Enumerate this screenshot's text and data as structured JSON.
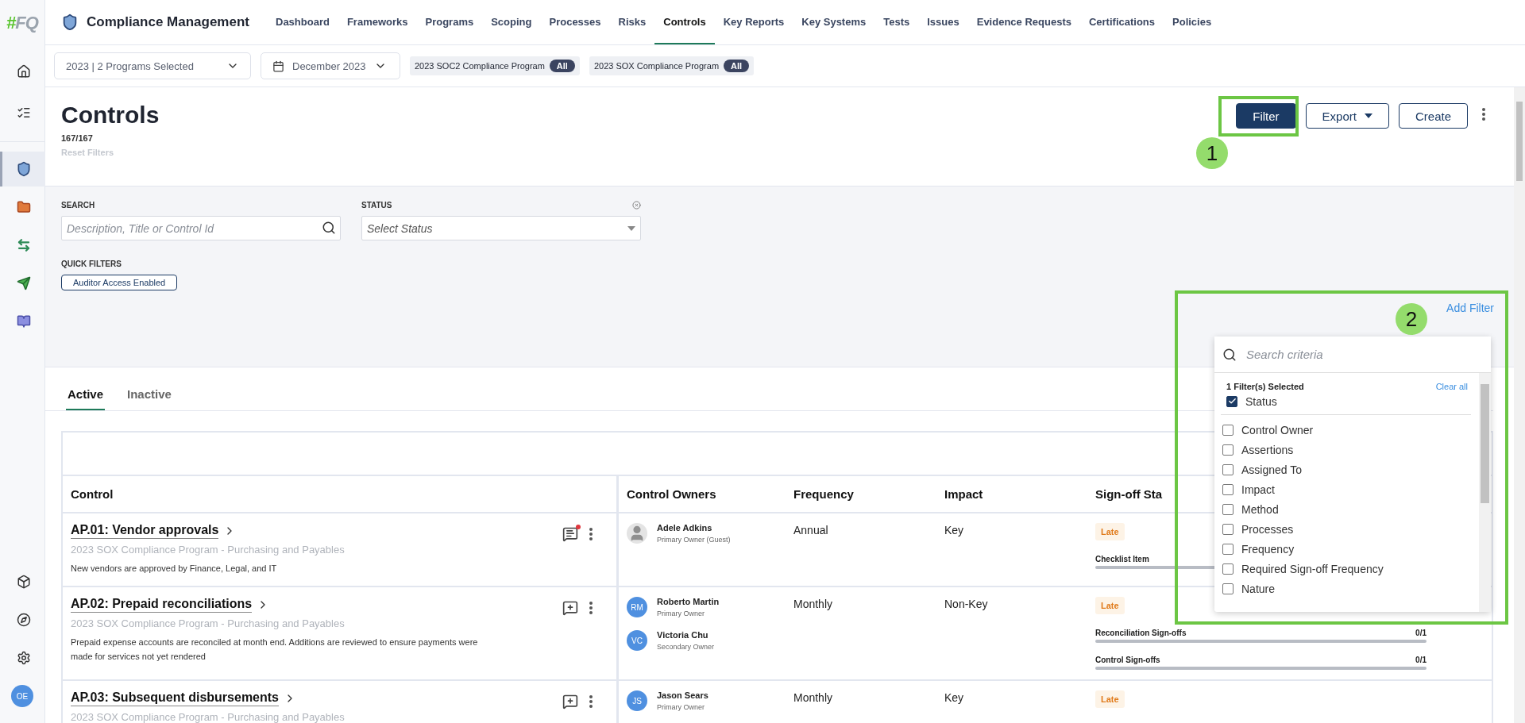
{
  "sidebar": {
    "logo": {
      "mark": "#",
      "letters": "FQ"
    },
    "items": [
      {
        "kind": "home",
        "selected": false
      },
      {
        "kind": "tasks",
        "selected": false
      },
      {
        "kind": "compliance",
        "selected": true
      },
      {
        "kind": "folder",
        "selected": false
      },
      {
        "kind": "sync",
        "selected": false
      },
      {
        "kind": "send",
        "selected": false
      },
      {
        "kind": "book",
        "selected": false
      }
    ],
    "bottom": [
      {
        "kind": "cube"
      },
      {
        "kind": "compass"
      },
      {
        "kind": "settings"
      }
    ],
    "user_initials": "OE"
  },
  "app_title": "Compliance Management",
  "nav": [
    {
      "label": "Dashboard",
      "selected": false
    },
    {
      "label": "Frameworks",
      "selected": false
    },
    {
      "label": "Programs",
      "selected": false
    },
    {
      "label": "Scoping",
      "selected": false
    },
    {
      "label": "Processes",
      "selected": false
    },
    {
      "label": "Risks",
      "selected": false
    },
    {
      "label": "Controls",
      "selected": true
    },
    {
      "label": "Key Reports",
      "selected": false
    },
    {
      "label": "Key Systems",
      "selected": false
    },
    {
      "label": "Tests",
      "selected": false
    },
    {
      "label": "Issues",
      "selected": false
    },
    {
      "label": "Evidence Requests",
      "selected": false
    },
    {
      "label": "Certifications",
      "selected": false
    },
    {
      "label": "Policies",
      "selected": false
    }
  ],
  "program_select": "2023 | 2 Programs Selected",
  "period_select": "December 2023",
  "program_chips": [
    {
      "name": "2023 SOC2 Compliance Program",
      "badge": "All"
    },
    {
      "name": "2023 SOX Compliance Program",
      "badge": "All"
    }
  ],
  "page": {
    "title": "Controls",
    "count": "167/167",
    "reset": "Reset Filters"
  },
  "actions": {
    "filter": "Filter",
    "export": "Export",
    "create": "Create"
  },
  "filters": {
    "search_label": "SEARCH",
    "search_placeholder": "Description, Title or Control Id",
    "status_label": "STATUS",
    "status_placeholder": "Select Status",
    "quick_label": "QUICK FILTERS",
    "quick_chips": [
      "Auditor Access Enabled"
    ],
    "add_filter": "Add Filter"
  },
  "tabs": [
    {
      "label": "Active",
      "selected": true
    },
    {
      "label": "Inactive",
      "selected": false
    }
  ],
  "table": {
    "columns": [
      "Control",
      "Control Owners",
      "Frequency",
      "Impact",
      "Sign-off Sta"
    ],
    "rows": [
      {
        "title": "AP.01: Vendor approvals",
        "program": "2023 SOX Compliance Program - Purchasing and Payables",
        "description": "New vendors are approved by Finance, Legal, and IT",
        "unread_comments": true,
        "owners": [
          {
            "name": "Adele Adkins",
            "role": "Primary Owner (Guest)",
            "kind": "guest"
          }
        ],
        "frequency": "Annual",
        "impact": "Key",
        "status": "Late",
        "signoffs": [
          {
            "label": "Checklist Item",
            "level": 0
          }
        ]
      },
      {
        "title": "AP.02: Prepaid reconciliations",
        "program": "2023 SOX Compliance Program - Purchasing and Payables",
        "description": "Prepaid expense accounts are reconciled at month end. Additions are reviewed to ensure payments were made for services not yet rendered",
        "unread_comments": false,
        "owners": [
          {
            "name": "Roberto Martin",
            "role": "Primary Owner",
            "kind": "member",
            "initials": "RM"
          },
          {
            "name": "Victoria Chu",
            "role": "Secondary Owner",
            "kind": "member",
            "initials": "VC"
          }
        ],
        "frequency": "Monthly",
        "impact": "Non-Key",
        "status": "Late",
        "signoffs": [
          {
            "label": "Reconciliation Sign-offs",
            "value": "0/1",
            "level": 0
          },
          {
            "label": "Control Sign-offs",
            "value": "0/1",
            "level": 0
          }
        ]
      },
      {
        "title": "AP.03: Subsequent disbursements",
        "program": "2023 SOX Compliance Program - Purchasing and Payables",
        "unread_comments": false,
        "owners": [
          {
            "name": "Jason Sears",
            "role": "Primary Owner",
            "kind": "member",
            "initials": "JS"
          }
        ],
        "frequency": "Monthly",
        "impact": "Key",
        "status": "Late",
        "signoffs": []
      }
    ]
  },
  "criteria_menu": {
    "placeholder": "Search criteria",
    "summary": "1 Filter(s) Selected",
    "clear": "Clear all",
    "selected": [
      {
        "label": "Status",
        "checked": true
      }
    ],
    "options": [
      {
        "label": "Control Owner",
        "checked": false
      },
      {
        "label": "Assertions",
        "checked": false
      },
      {
        "label": "Assigned To",
        "checked": false
      },
      {
        "label": "Impact",
        "checked": false
      },
      {
        "label": "Method",
        "checked": false
      },
      {
        "label": "Processes",
        "checked": false
      },
      {
        "label": "Frequency",
        "checked": false
      },
      {
        "label": "Required Sign-off Frequency",
        "checked": false
      },
      {
        "label": "Nature",
        "checked": false
      }
    ]
  },
  "callouts": [
    {
      "number": "1"
    },
    {
      "number": "2"
    }
  ]
}
